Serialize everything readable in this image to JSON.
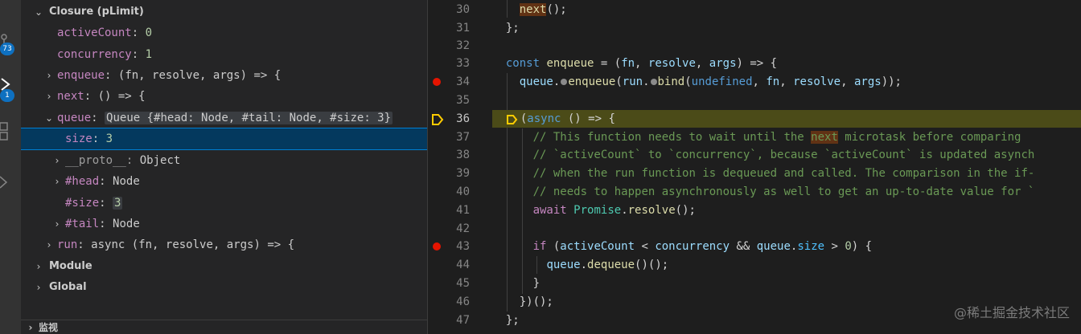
{
  "activity_bar": {
    "icons": [
      "source-control-icon",
      "run-debug-icon",
      "extensions-icon",
      "remote-explorer-icon"
    ],
    "badges": [
      "73",
      "1"
    ]
  },
  "variables": {
    "closure_scope": "Closure (pLimit)",
    "items": [
      {
        "name": "activeCount",
        "value": "0"
      },
      {
        "name": "concurrency",
        "value": "1"
      },
      {
        "name": "enqueue",
        "value": "(fn, resolve, args) => {"
      },
      {
        "name": "next",
        "value": "() => {"
      },
      {
        "name": "queue",
        "value": "Queue {#head: Node, #tail: Node, #size: 3}"
      },
      {
        "name": "size",
        "value": "3"
      },
      {
        "name": "__proto__",
        "value": "Object"
      },
      {
        "name": "#head",
        "value": "Node"
      },
      {
        "name": "#size",
        "value": "3"
      },
      {
        "name": "#tail",
        "value": "Node"
      },
      {
        "name": "run",
        "value": "async (fn, resolve, args) => {"
      }
    ],
    "colon": ":",
    "module_scope": "Module",
    "global_scope": "Global",
    "watch_section": "监视"
  },
  "editor": {
    "line_numbers": [
      "30",
      "31",
      "32",
      "33",
      "34",
      "35",
      "36",
      "37",
      "38",
      "39",
      "40",
      "41",
      "42",
      "43",
      "44",
      "45",
      "46",
      "47"
    ],
    "active_line": "36",
    "code": {
      "l30": {
        "a": "next",
        "b": "();"
      },
      "l31": {
        "a": "};"
      },
      "l33": {
        "kw": "const",
        "fn": "enqueue",
        "op": " = (",
        "p1": "fn",
        "c1": ", ",
        "p2": "resolve",
        "c2": ", ",
        "p3": "args",
        "arrow": ") => {"
      },
      "l34": {
        "q": "queue",
        "d1": ".",
        "m1": "enqueue",
        "o": "(",
        "r": "run",
        "d2": ".",
        "m2": "bind",
        "o2": "(",
        "u": "undefined",
        "c": ", ",
        "fn": "fn",
        "c2": ", ",
        "res": "resolve",
        "c3": ", ",
        "args": "args",
        "end": "));"
      },
      "l36": {
        "a": "(",
        "kw": "async",
        "b": " () => {"
      },
      "l37": {
        "a": "// This function needs to wait until the ",
        "hl": "next",
        "b": " microtask before comparing"
      },
      "l38": {
        "a": "// `activeCount` to `concurrency`, because `activeCount` is updated asynch"
      },
      "l39": {
        "a": "// when the run function is dequeued and called. The comparison in the if-"
      },
      "l40": {
        "a": "// needs to happen asynchronously as well to get an up-to-date value for `"
      },
      "l41": {
        "kw": "await",
        "sp": " ",
        "cls": "Promise",
        "d": ".",
        "fn": "resolve",
        "end": "();"
      },
      "l43": {
        "kw": "if",
        "a": " (",
        "v1": "activeCount",
        "op1": " < ",
        "v2": "concurrency",
        "op2": " && ",
        "v3": "queue",
        "d": ".",
        "p": "size",
        "op3": " > ",
        "n": "0",
        "end": ") {"
      },
      "l44": {
        "v": "queue",
        "d": ".",
        "fn": "dequeue",
        "end": "()();"
      },
      "l45": {
        "a": "}"
      },
      "l46": {
        "a": "})();"
      },
      "l47": {
        "a": "};"
      }
    }
  },
  "watermark": "@稀土掘金技术社区",
  "colors": {
    "background": "#1e1e1e",
    "panel": "#252526",
    "selection": "#04395e",
    "paused_line": "#4b4b18",
    "breakpoint": "#e51400",
    "badge": "#0e70c0"
  }
}
